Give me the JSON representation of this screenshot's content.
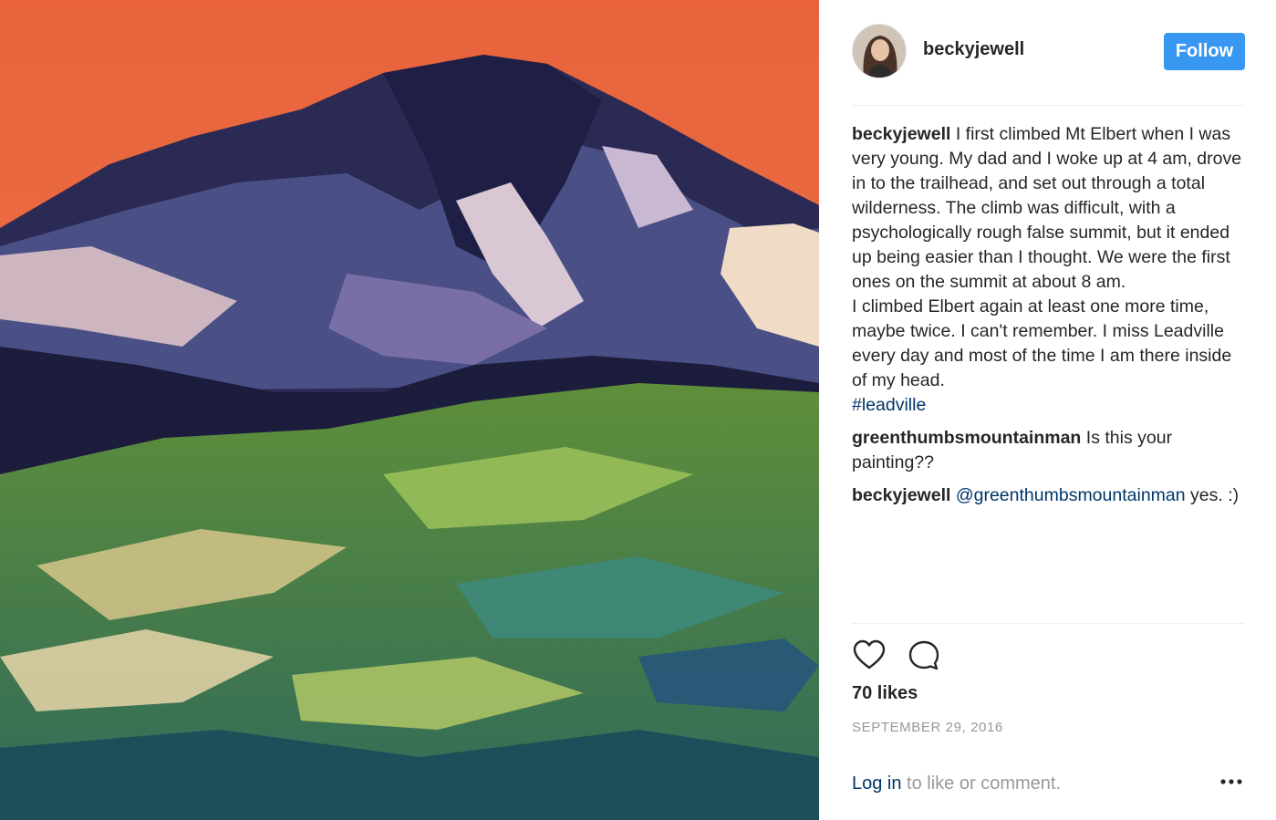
{
  "post": {
    "username": "beckyjewell",
    "follow_label": "Follow",
    "image_description_icon": "painting-image"
  },
  "caption": {
    "author": "beckyjewell",
    "text": "I first climbed Mt Elbert when I was very young. My dad and I woke up at 4 am, drove in to the trailhead, and set out through a total wilderness. The climb was difficult, with a psychologically rough false summit, but it ended up being easier than I thought. We were the first ones on the summit at about 8 am.\nI climbed Elbert again at least one more time, maybe twice. I can't remember. I miss Leadville every day and most of the time I am there inside of my head.",
    "hashtag": "#leadville"
  },
  "comments": [
    {
      "author": "greenthumbsmountainman",
      "text": "Is this your painting??"
    },
    {
      "author": "beckyjewell",
      "mention": "@greenthumbsmountainman",
      "text": "yes. :)"
    }
  ],
  "actions": {
    "like_icon": "heart-icon",
    "comment_icon": "comment-bubble-icon",
    "likes_text": "70 likes",
    "date": "SEPTEMBER 29, 2016"
  },
  "footer": {
    "login_label": "Log in",
    "rest_text": " to like or comment.",
    "more_icon": "more-options-icon"
  },
  "colors": {
    "accent": "#3897f0",
    "link": "#003569",
    "muted": "#999999",
    "text": "#262626"
  }
}
